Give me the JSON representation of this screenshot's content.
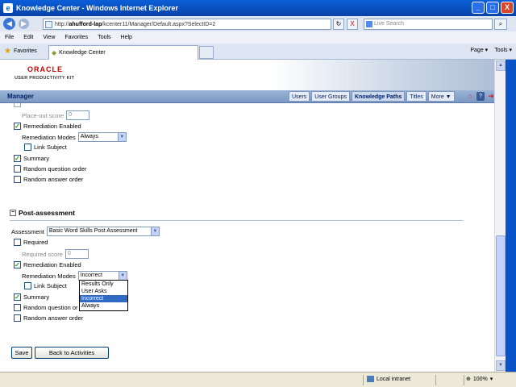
{
  "window": {
    "title": "Knowledge Center - Windows Internet Explorer",
    "min": "_",
    "max": "□",
    "close": "X"
  },
  "address": {
    "prefix": "http://",
    "host": "ahufford-lap",
    "path": "/kcenter11/Manager/Default.aspx?SelectID=2",
    "refresh": "↻",
    "stop": "X"
  },
  "search": {
    "placeholder": "Live Search",
    "go": "⌕"
  },
  "menu": [
    "File",
    "Edit",
    "View",
    "Favorites",
    "Tools",
    "Help"
  ],
  "favorites_label": "Favorites",
  "tab_label": "Knowledge Center",
  "tab_tools": {
    "page": "Page ▾",
    "tools": "Tools ▾"
  },
  "brand": {
    "oracle": "ORACLE",
    "upk": "USER PRODUCTIVITY KIT"
  },
  "manager": {
    "title": "Manager",
    "tabs": [
      "Users",
      "User Groups",
      "Knowledge Paths",
      "Titles",
      "More ▼"
    ],
    "selected_tab": "Knowledge Paths",
    "icons": [
      "home-icon",
      "help-icon",
      "logout-icon"
    ]
  },
  "pre": {
    "placeout_label": "Place-out score",
    "placeout_value": "0",
    "remediation_enabled": "Remediation Enabled",
    "remediation_modes_label": "Remediation Modes",
    "remediation_modes_value": "Always",
    "link_subject": "Link Subject",
    "summary": "Summary",
    "random_question": "Random question order",
    "random_answer": "Random answer order"
  },
  "post": {
    "section_title": "Post-assessment",
    "assessment_label": "Assessment",
    "assessment_value": "Basic Word Skills Post Assessment",
    "required": "Required",
    "required_score_label": "Required score",
    "required_score_value": "0",
    "remediation_enabled": "Remediation Enabled",
    "remediation_modes_label": "Remediation Modes",
    "remediation_modes_value": "Incorrect",
    "dropdown_options": [
      "Results Only",
      "User Asks",
      "Incorrect",
      "Always"
    ],
    "dropdown_selected": "Incorrect",
    "link_subject": "Link Subject",
    "summary": "Summary",
    "random_question": "Random question or",
    "random_answer": "Random answer order"
  },
  "buttons": {
    "save": "Save",
    "back": "Back to Activities"
  },
  "status": {
    "zone": "Local intranet",
    "zoom": "100%"
  },
  "colors": {
    "accent": "#316ac5",
    "header": "#7c98c3",
    "brand_red": "#cc0000"
  }
}
